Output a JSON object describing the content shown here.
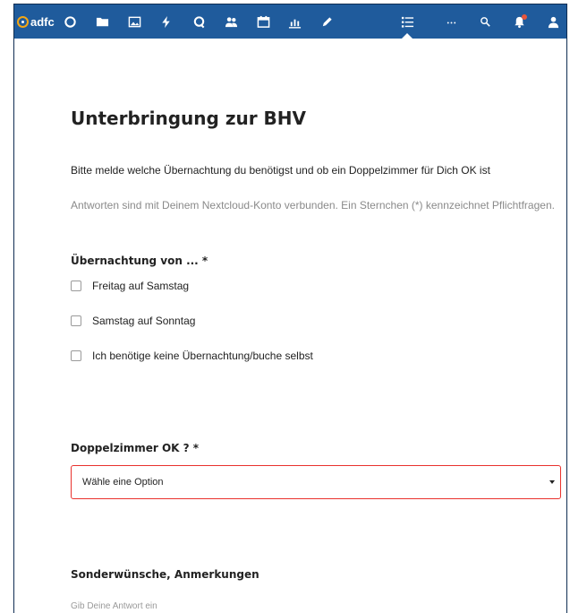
{
  "app": {
    "logo_text": "adfc",
    "nav_icons": [
      "dashboard-icon",
      "folder-icon",
      "image-icon",
      "activity-icon",
      "talk-icon",
      "contacts-icon",
      "calendar-icon",
      "analytics-icon",
      "notes-icon",
      "forms-icon",
      "more-icon",
      "search-icon",
      "notifications-icon",
      "user-icon"
    ],
    "active_app": "forms-icon",
    "colors": {
      "header_bg": "#1f5b9c",
      "logo_accent": "#f3a614",
      "error_border": "#e9322d",
      "notification_dot": "#e6563c"
    }
  },
  "form": {
    "title": "Unterbringung zur BHV",
    "description": "Bitte melde welche Übernachtung du benötigst und ob ein Doppelzimmer für Dich OK ist",
    "info": "Antworten sind mit Deinem Nextcloud-Konto verbunden. Ein Sternchen (*) kennzeichnet Pflichtfragen."
  },
  "questions": [
    {
      "title": "Übernachtung von ... *",
      "type": "checkbox",
      "options": [
        {
          "label": "Freitag auf Samstag",
          "checked": false
        },
        {
          "label": "Samstag auf Sonntag",
          "checked": false
        },
        {
          "label": "Ich benötige keine Übernachtung/buche selbst",
          "checked": false
        }
      ]
    },
    {
      "title": "Doppelzimmer OK ? *",
      "type": "dropdown",
      "placeholder": "Wähle eine Option"
    },
    {
      "title": "Sonderwünsche, Anmerkungen",
      "type": "text",
      "placeholder": "Gib Deine Antwort ein",
      "value": ""
    }
  ]
}
